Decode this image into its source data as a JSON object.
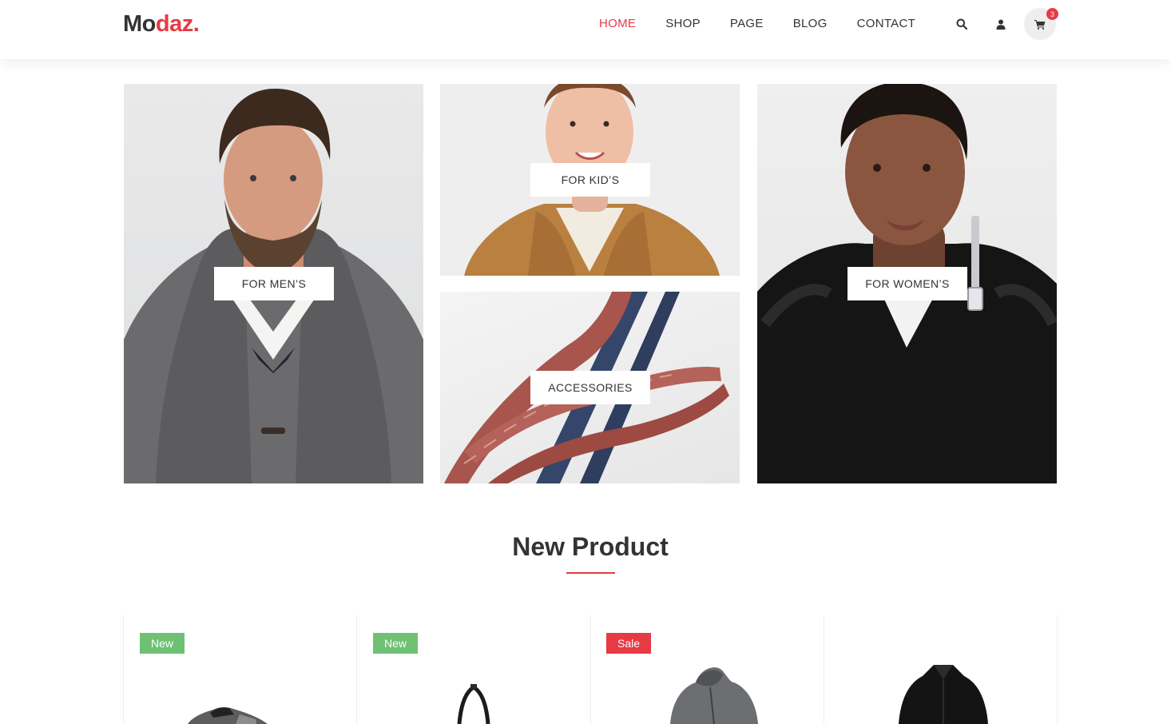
{
  "brand": {
    "logo_dark": "Mo",
    "logo_accent": "daz."
  },
  "nav": {
    "items": [
      {
        "label": "HOME",
        "active": true
      },
      {
        "label": "SHOP",
        "active": false
      },
      {
        "label": "PAGE",
        "active": false
      },
      {
        "label": "BLOG",
        "active": false
      },
      {
        "label": "CONTACT",
        "active": false
      }
    ]
  },
  "header_icons": {
    "search": "search-icon",
    "account": "user-icon",
    "cart": "cart-icon",
    "cart_count": "3"
  },
  "categories": [
    {
      "label": "FOR MEN’S"
    },
    {
      "label": "FOR KID’S"
    },
    {
      "label": "ACCESSORIES"
    },
    {
      "label": "FOR WOMEN’S"
    }
  ],
  "section": {
    "title": "New Product"
  },
  "products": [
    {
      "badge": "New",
      "image": "sneaker"
    },
    {
      "badge": "New",
      "image": "handbag"
    },
    {
      "badge": "Sale",
      "image": "hooded-coat"
    },
    {
      "badge": "",
      "image": "black-jacket"
    }
  ],
  "colors": {
    "accent": "#e63a45",
    "new_badge": "#6ec173",
    "text": "#333333"
  }
}
